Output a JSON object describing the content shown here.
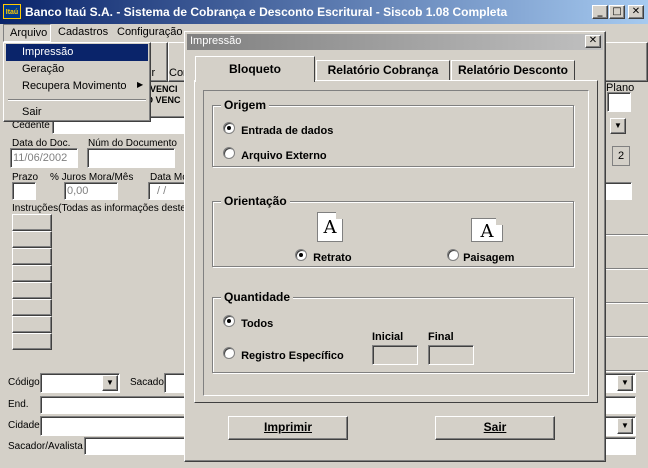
{
  "app": {
    "logo": "Itaú",
    "title": "Banco Itaú S.A. - Sistema de Cobrança e Desconto Escritural - Siscob 1.08 Completa"
  },
  "menubar": {
    "items": [
      "Arquivo",
      "Cadastros",
      "Configuração"
    ]
  },
  "arquivo_menu": {
    "items": [
      "Impressão",
      "Geração",
      "Recupera Movimento",
      "Sair"
    ]
  },
  "bg": {
    "vencido1": "VENCI",
    "vencido2": "O VENC",
    "cedente": "Cedente",
    "toolbar_ir": "ir",
    "toolbar_con": "Con",
    "plano": "/Plano",
    "data_doc_label": "Data do Doc.",
    "data_doc_value": "11/06/2002",
    "num_doc_label": "Núm do Documento",
    "prazo_label": "Prazo",
    "juros_label": "% Juros Mora/Mês",
    "juros_value": "0,00",
    "data_m_label": "Data Mo",
    "data_m_value": "/ /",
    "instrucoes_label": "Instruções(Todas as informações deste b",
    "codigo_label": "Código",
    "sacado_label": "Sacado",
    "end_label": "End.",
    "cidade_label": "Cidade",
    "sacador_label": "Sacador/Avalista",
    "page_num": "2"
  },
  "dialog": {
    "title": "Impressão",
    "tabs": [
      "Bloqueto",
      "Relatório Cobrança",
      "Relatório Desconto"
    ],
    "origem": {
      "title": "Origem",
      "options": [
        "Entrada de dados",
        "Arquivo Externo"
      ],
      "selected": "Entrada de dados"
    },
    "orientacao": {
      "title": "Orientação",
      "options": [
        "Retrato",
        "Paisagem"
      ],
      "selected": "Retrato",
      "icon_letter": "A"
    },
    "quantidade": {
      "title": "Quantidade",
      "options": [
        "Todos",
        "Registro Específico"
      ],
      "selected": "Todos",
      "inicial_label": "Inicial",
      "final_label": "Final",
      "inicial_value": "",
      "final_value": ""
    },
    "buttons": {
      "imprimir": "Imprimir",
      "sair": "Sair"
    }
  }
}
